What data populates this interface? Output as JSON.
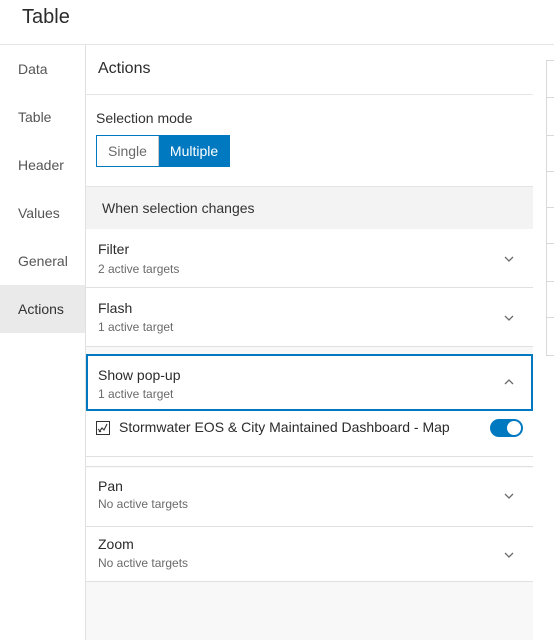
{
  "app": {
    "title": "Table"
  },
  "sidebar": {
    "items": [
      {
        "label": "Data"
      },
      {
        "label": "Table"
      },
      {
        "label": "Header"
      },
      {
        "label": "Values"
      },
      {
        "label": "General"
      },
      {
        "label": "Actions",
        "active": true
      }
    ]
  },
  "panel": {
    "title": "Actions",
    "selection_mode": {
      "label": "Selection mode",
      "options": [
        "Single",
        "Multiple"
      ],
      "selected": "Multiple"
    },
    "when_selection_changes": "When selection changes",
    "actions": [
      {
        "name": "Filter",
        "status": "2 active targets",
        "expanded": false
      },
      {
        "name": "Flash",
        "status": "1 active target",
        "expanded": false
      },
      {
        "name": "Show pop-up",
        "status": "1 active target",
        "expanded": true
      },
      {
        "name": "Pan",
        "status": "No active targets",
        "expanded": false
      },
      {
        "name": "Zoom",
        "status": "No active targets",
        "expanded": false
      }
    ],
    "popup_target": {
      "label": "Stormwater EOS & City Maintained Dashboard - Map",
      "enabled": true,
      "icon": "map-widget-icon"
    }
  },
  "colors": {
    "accent": "#0079c1",
    "active_sidebar_bg": "#eaeaea",
    "section_bg": "#f3f3f3"
  }
}
